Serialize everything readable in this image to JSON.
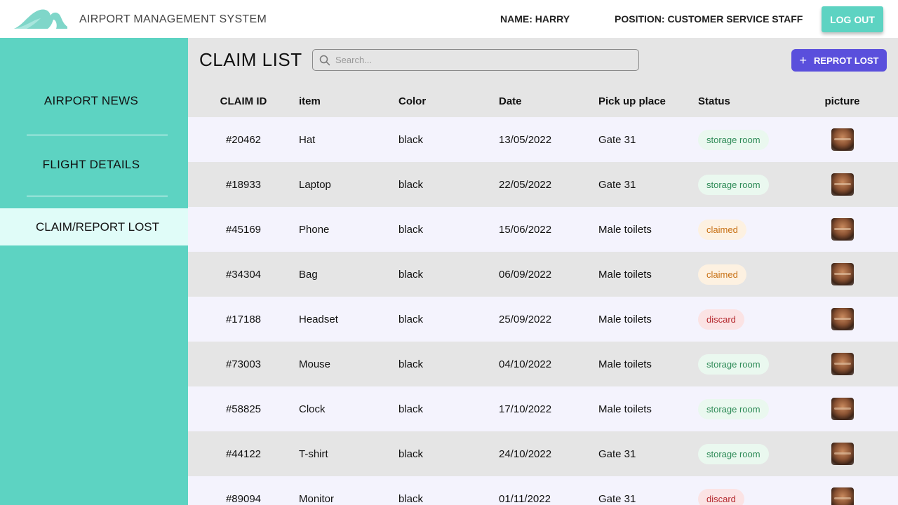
{
  "header": {
    "app_title": "AIRPORT MANAGEMENT SYSTEM",
    "user_name": "NAME: HARRY",
    "user_position": "POSITION: CUSTOMER SERVICE STAFF",
    "logout_label": "LOG OUT"
  },
  "sidebar": {
    "items": [
      {
        "label": "AIRPORT NEWS"
      },
      {
        "label": "FLIGHT DETAILS"
      },
      {
        "label": "CLAIM/REPORT LOST",
        "active": true
      }
    ]
  },
  "main": {
    "title": "CLAIM LIST",
    "search_placeholder": "Search...",
    "report_button_label": "REPROT LOST",
    "columns": [
      "CLAIM ID",
      "item",
      "Color",
      "Date",
      "Pick up place",
      "Status",
      "picture"
    ],
    "rows": [
      {
        "id": "#20462",
        "item": "Hat",
        "color": "black",
        "date": "13/05/2022",
        "place": "Gate 31",
        "status": "storage room",
        "status_type": "storage"
      },
      {
        "id": "#18933",
        "item": "Laptop",
        "color": "black",
        "date": "22/05/2022",
        "place": "Gate 31",
        "status": "storage room",
        "status_type": "storage"
      },
      {
        "id": "#45169",
        "item": "Phone",
        "color": "black",
        "date": "15/06/2022",
        "place": "Male toilets",
        "status": "claimed",
        "status_type": "claimed"
      },
      {
        "id": "#34304",
        "item": "Bag",
        "color": "black",
        "date": "06/09/2022",
        "place": "Male toilets",
        "status": "claimed",
        "status_type": "claimed"
      },
      {
        "id": "#17188",
        "item": "Headset",
        "color": "black",
        "date": "25/09/2022",
        "place": "Male toilets",
        "status": "discard",
        "status_type": "discard"
      },
      {
        "id": "#73003",
        "item": "Mouse",
        "color": "black",
        "date": "04/10/2022",
        "place": "Male toilets",
        "status": "storage room",
        "status_type": "storage"
      },
      {
        "id": "#58825",
        "item": "Clock",
        "color": "black",
        "date": "17/10/2022",
        "place": "Male toilets",
        "status": "storage room",
        "status_type": "storage"
      },
      {
        "id": "#44122",
        "item": "T-shirt",
        "color": "black",
        "date": "24/10/2022",
        "place": "Gate 31",
        "status": "storage room",
        "status_type": "storage"
      },
      {
        "id": "#89094",
        "item": "Monitor",
        "color": "black",
        "date": "01/11/2022",
        "place": "Gate 31",
        "status": "discard",
        "status_type": "discard"
      }
    ]
  },
  "colors": {
    "accent": "#5dd3c2",
    "button_primary": "#5a4fdc",
    "sidebar_active_bg": "#e0fcf8"
  },
  "icons": {
    "logo": "wave-logo-icon",
    "search": "search-icon",
    "add": "plus-icon",
    "picture": "item-thumbnail"
  }
}
